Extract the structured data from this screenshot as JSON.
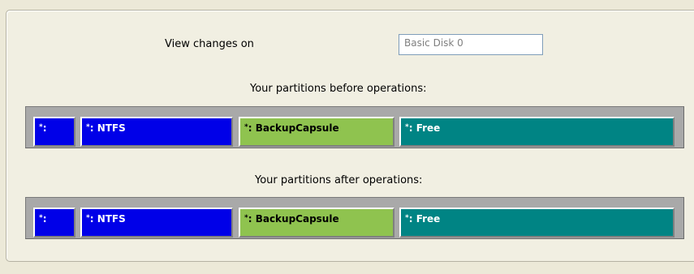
{
  "view": {
    "label": "View changes on",
    "disk_value": "Basic Disk 0"
  },
  "before": {
    "caption": "Your partitions before operations:",
    "partitions": [
      {
        "prefix": "*",
        "label": ":",
        "color": "#0000E8"
      },
      {
        "prefix": "*",
        "label": ": NTFS",
        "color": "#0000E8"
      },
      {
        "prefix": "*",
        "label": ": BackupCapsule",
        "color": "#8FC34F"
      },
      {
        "prefix": "*",
        "label": ": Free",
        "color": "#008484"
      }
    ]
  },
  "after": {
    "caption": "Your partitions after operations:",
    "partitions": [
      {
        "prefix": "*",
        "label": ":",
        "color": "#0000E8"
      },
      {
        "prefix": "*",
        "label": ": NTFS",
        "color": "#0000E8"
      },
      {
        "prefix": "*",
        "label": ": BackupCapsule",
        "color": "#8FC34F"
      },
      {
        "prefix": "*",
        "label": ": Free",
        "color": "#008484"
      }
    ]
  }
}
